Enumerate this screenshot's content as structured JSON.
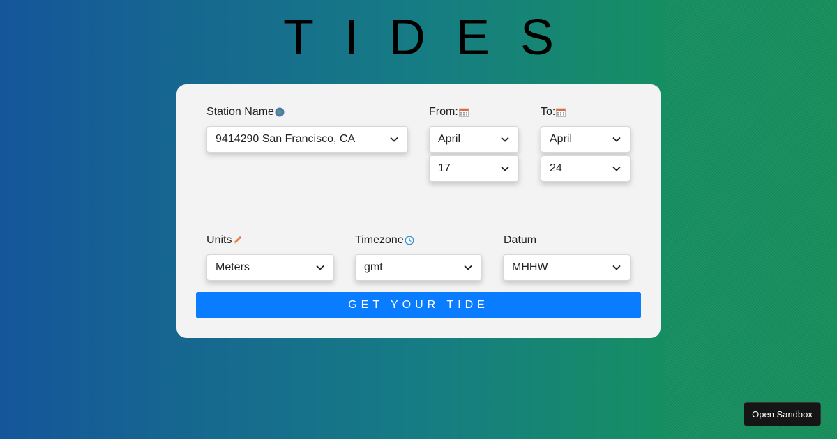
{
  "page": {
    "title": "TIDES"
  },
  "form": {
    "station": {
      "label": "Station Name",
      "icon": "globe-icon",
      "value": "9414290 San Francisco, CA"
    },
    "from": {
      "label": "From:",
      "icon": "calendar-icon",
      "month": "April",
      "day": "17"
    },
    "to": {
      "label": "To:",
      "icon": "calendar-icon",
      "month": "April",
      "day": "24"
    },
    "units": {
      "label": "Units",
      "icon": "pencil-icon",
      "value": "Meters"
    },
    "timezone": {
      "label": "Timezone",
      "icon": "clock-icon",
      "value": "gmt"
    },
    "datum": {
      "label": "Datum",
      "value": "MHHW"
    },
    "submit_label": "GET YOUR TIDE"
  },
  "sandbox_label": "Open Sandbox",
  "colors": {
    "button": "#0a7cff",
    "card": "#f3f3f3",
    "gradient_start": "#15569a",
    "gradient_end": "#178f5c"
  }
}
